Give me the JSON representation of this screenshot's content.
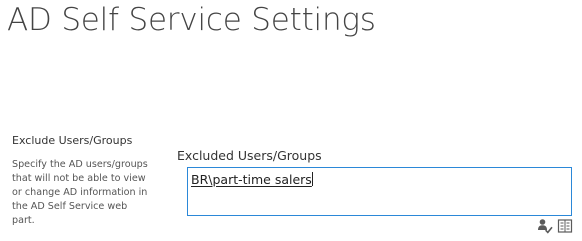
{
  "page": {
    "title": "AD Self Service Settings"
  },
  "exclude_section": {
    "heading": "Exclude Users/Groups",
    "description": "Specify the AD users/groups that will not be able to view or change AD information in the AD Self Service web part."
  },
  "excluded_field": {
    "label": "Excluded Users/Groups",
    "value": "BR\\part-time salers"
  },
  "icons": {
    "check_names": "check-names-icon",
    "browse": "address-book-icon"
  }
}
